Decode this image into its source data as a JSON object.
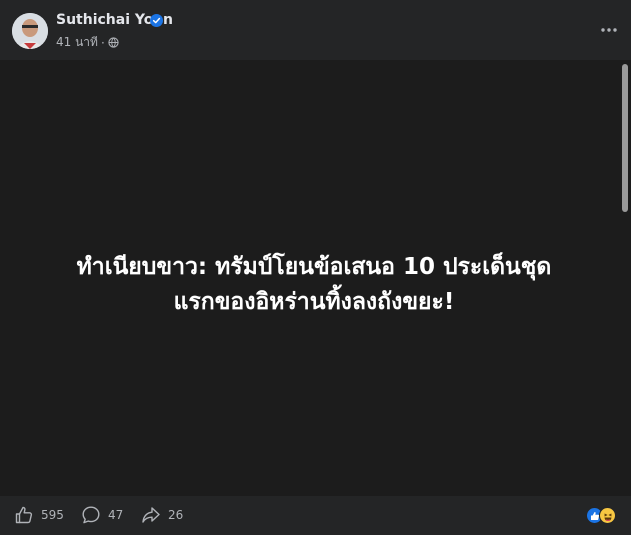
{
  "post": {
    "author": "Suthichai Yoon",
    "time": "41 นาที",
    "separator": "·",
    "headline_line1": "ทำเนียบขาว: ทรัมป์โยนข้อเสนอ 10 ประเด็นชุด",
    "headline_line2": "แรกของอิหร่านทิ้งลงถังขยะ!"
  },
  "footer": {
    "likes": "595",
    "comments": "47",
    "shares": "26"
  },
  "icons": {
    "verified": "verified-badge-icon",
    "globe": "globe-icon",
    "more": "more-options-icon",
    "like": "thumbs-up-icon",
    "comment": "comment-bubble-icon",
    "share": "share-arrow-icon",
    "reactions": [
      "like-reaction-icon",
      "haha-reaction-icon"
    ]
  },
  "colors": {
    "card_background": "#242526",
    "media_background": "#1c1c1c",
    "text_primary": "#e4e6eb",
    "text_secondary": "#b0b3b8",
    "verified_blue": "#1b74e4"
  }
}
